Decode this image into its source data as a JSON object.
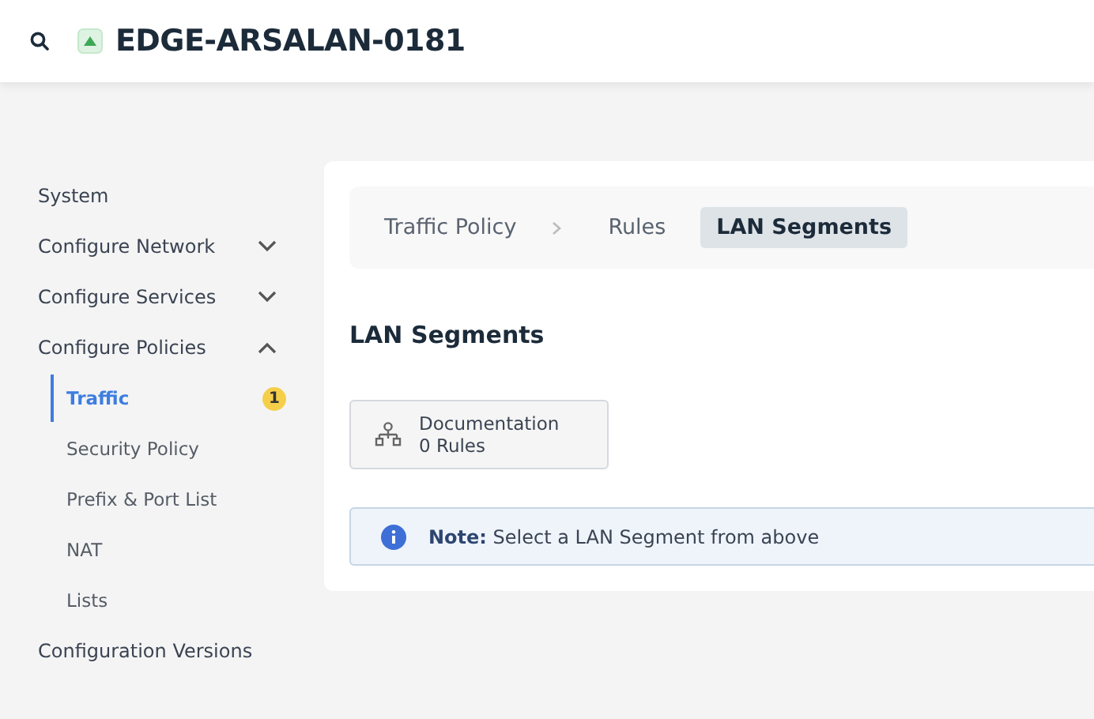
{
  "header": {
    "title": "EDGE-ARSALAN-0181",
    "online": true
  },
  "sidebar": {
    "items": [
      {
        "label": "System",
        "kind": "link"
      },
      {
        "label": "Configure Network",
        "kind": "group",
        "expanded": false
      },
      {
        "label": "Configure Services",
        "kind": "group",
        "expanded": false
      },
      {
        "label": "Configure Policies",
        "kind": "group",
        "expanded": true,
        "children": [
          {
            "label": "Traffic",
            "selected": true,
            "badge": "1"
          },
          {
            "label": "Security Policy",
            "selected": false
          },
          {
            "label": "Prefix & Port List",
            "selected": false
          },
          {
            "label": "NAT",
            "selected": false
          },
          {
            "label": "Lists",
            "selected": false
          }
        ]
      },
      {
        "label": "Configuration Versions",
        "kind": "link"
      }
    ]
  },
  "breadcrumb": [
    {
      "label": "Traffic Policy",
      "selected": false
    },
    {
      "label": "Rules",
      "selected": false
    },
    {
      "label": "LAN Segments",
      "selected": true
    }
  ],
  "heading": "LAN Segments",
  "segments": [
    {
      "name": "Documentation",
      "rules": "0 Rules"
    }
  ],
  "note": "**Note:** Select a LAN Segment from above"
}
